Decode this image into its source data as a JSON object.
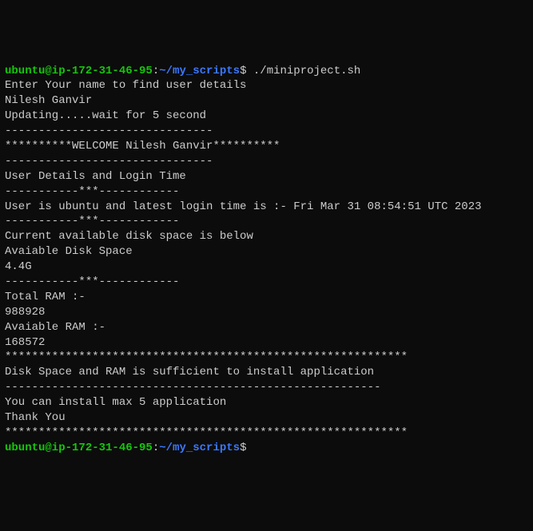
{
  "prompt1": {
    "user_host": "ubuntu@ip-172-31-46-95",
    "colon": ":",
    "path": "~/my_scripts",
    "dollar": "$ ",
    "command": "./miniproject.sh"
  },
  "output": {
    "l1": "Enter Your name to find user details",
    "l2": "Nilesh Ganvir",
    "l3": "Updating.....wait for 5 second",
    "l4": "-------------------------------",
    "l5": "**********WELCOME Nilesh Ganvir**********",
    "l6": "-------------------------------",
    "l7": "User Details and Login Time",
    "l8": "-----------***------------",
    "l9": "User is ubuntu and latest login time is :- Fri Mar 31 08:54:51 UTC 2023",
    "l10": "-----------***------------",
    "l11": "Current available disk space is below",
    "l12": "Avaiable Disk Space",
    "l13": "4.4G",
    "l14": "-----------***------------",
    "l15": "Total RAM :-",
    "l16": "988928",
    "l17": "Avaiable RAM :-",
    "l18": "168572",
    "l19": "************************************************************",
    "l20": "Disk Space and RAM is sufficient to install application",
    "l21": "--------------------------------------------------------",
    "l22": "You can install max 5 application",
    "l23": "Thank You",
    "l24": "************************************************************"
  },
  "prompt2": {
    "user_host": "ubuntu@ip-172-31-46-95",
    "colon": ":",
    "path": "~/my_scripts",
    "dollar": "$"
  }
}
